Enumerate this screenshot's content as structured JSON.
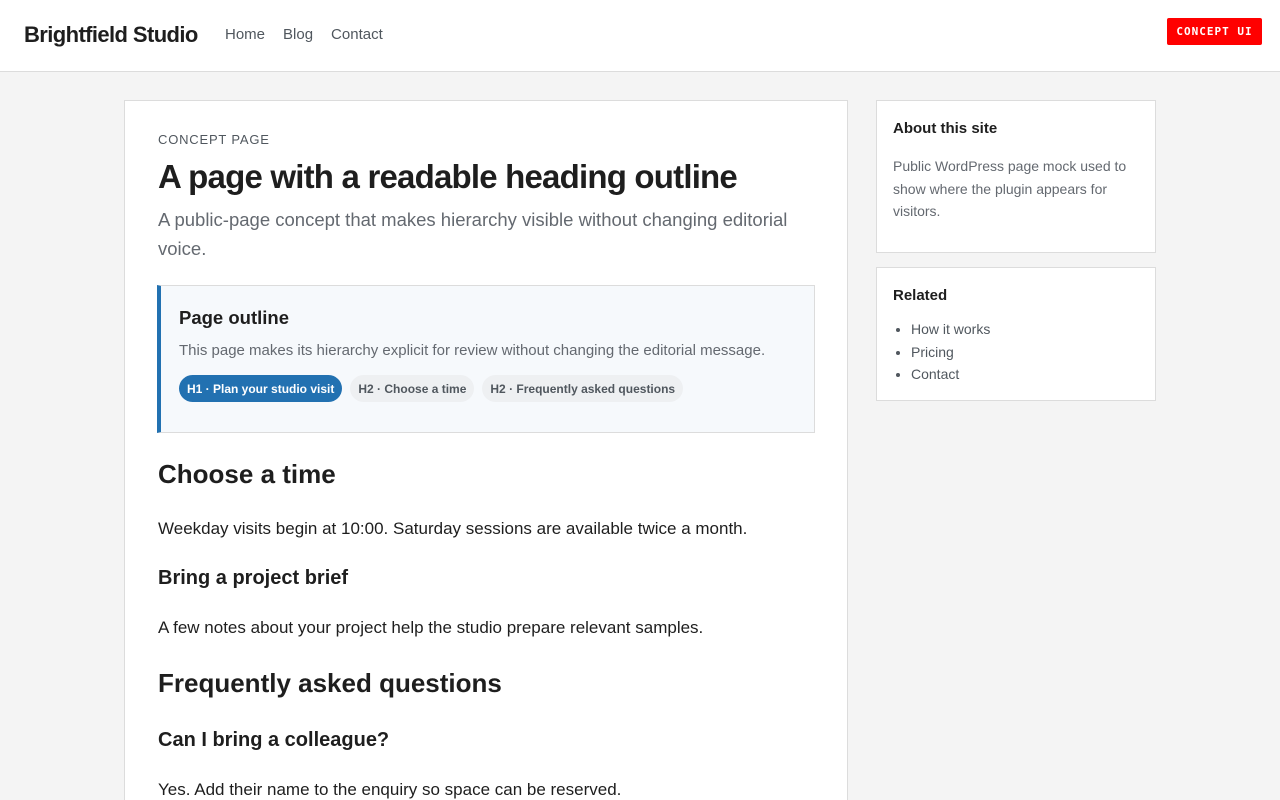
{
  "header": {
    "site_title": "Brightfield Studio",
    "nav": [
      "Home",
      "Blog",
      "Contact"
    ],
    "badge": "CONCEPT UI"
  },
  "main": {
    "eyebrow": "CONCEPT PAGE",
    "title": "A page with a readable heading outline",
    "lede": "A public-page concept that makes hierarchy visible without changing editorial voice.",
    "outline": {
      "title": "Page outline",
      "description": "This page makes its hierarchy explicit for review without changing the editorial message.",
      "pills": [
        "H1 · Plan your studio visit",
        "H2 · Choose a time",
        "H2 · Frequently asked questions"
      ]
    },
    "sections": {
      "choose_time_heading": "Choose a time",
      "choose_time_text": "Weekday visits begin at 10:00. Saturday sessions are available twice a month.",
      "brief_heading": "Bring a project brief",
      "brief_text": "A few notes about your project help the studio prepare relevant samples.",
      "faq_heading": "Frequently asked questions",
      "colleague_heading": "Can I bring a colleague?",
      "colleague_text": "Yes. Add their name to the enquiry so space can be reserved."
    }
  },
  "sidebar": {
    "about": {
      "title": "About this site",
      "text": "Public WordPress page mock used to show where the plugin appears for visitors."
    },
    "related": {
      "title": "Related",
      "items": [
        "How it works",
        "Pricing",
        "Contact"
      ]
    }
  },
  "colors": {
    "accent": "#2271b1",
    "badge": "#ff0000",
    "background": "#f4f4f4"
  }
}
